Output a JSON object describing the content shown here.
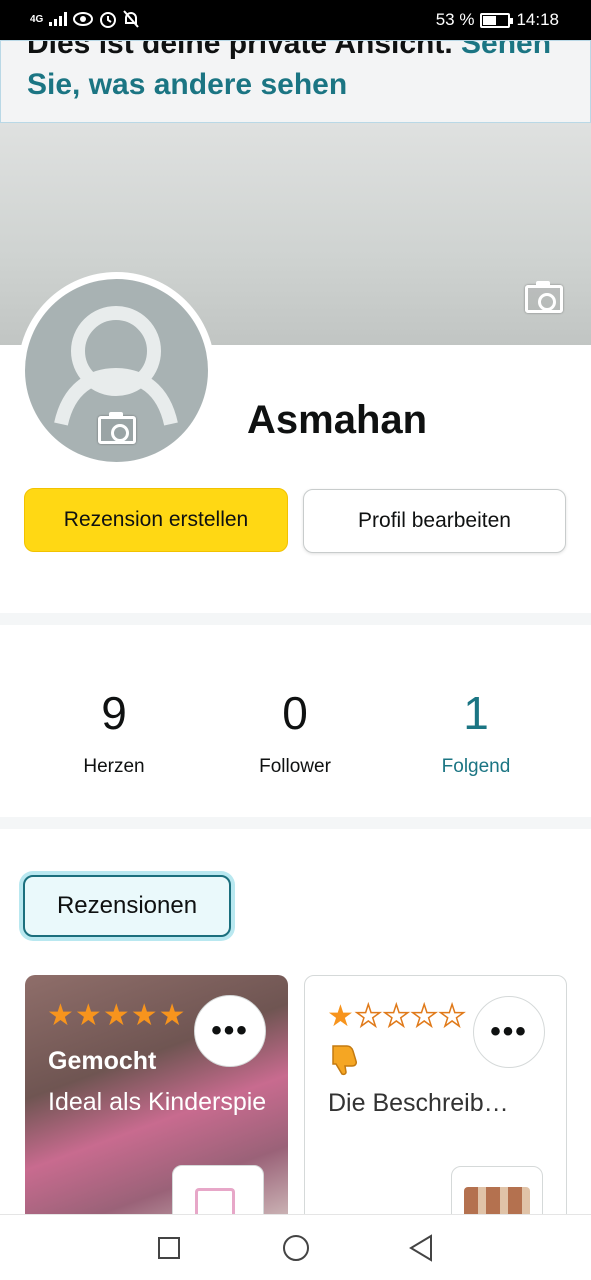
{
  "status_bar": {
    "network": "4G",
    "battery_percent": "53 %",
    "battery_level": 0.53,
    "time": "14:18"
  },
  "notice": {
    "text": "Dies ist deine private Ansicht.",
    "link": "Sehen Sie, was andere sehen"
  },
  "profile": {
    "name": "Asmahan"
  },
  "actions": {
    "primary": "Rezension erstellen",
    "secondary": "Profil bearbeiten"
  },
  "stats": [
    {
      "value": "9",
      "label": "Herzen"
    },
    {
      "value": "0",
      "label": "Follower"
    },
    {
      "value": "1",
      "label": "Folgend"
    }
  ],
  "tabs": {
    "active": "Rezensionen"
  },
  "reviews": [
    {
      "rating": 5,
      "max_rating": 5,
      "title": "Gemocht",
      "body": "Ideal als Kinderspie",
      "more": "•••"
    },
    {
      "rating": 1,
      "max_rating": 5,
      "icon": "thumbs-down-icon",
      "body": "Die Beschreib…",
      "more": "•••"
    }
  ],
  "colors": {
    "accent_teal": "#1b7583",
    "primary_yellow": "#ffd814",
    "star_orange": "#f7941d"
  }
}
